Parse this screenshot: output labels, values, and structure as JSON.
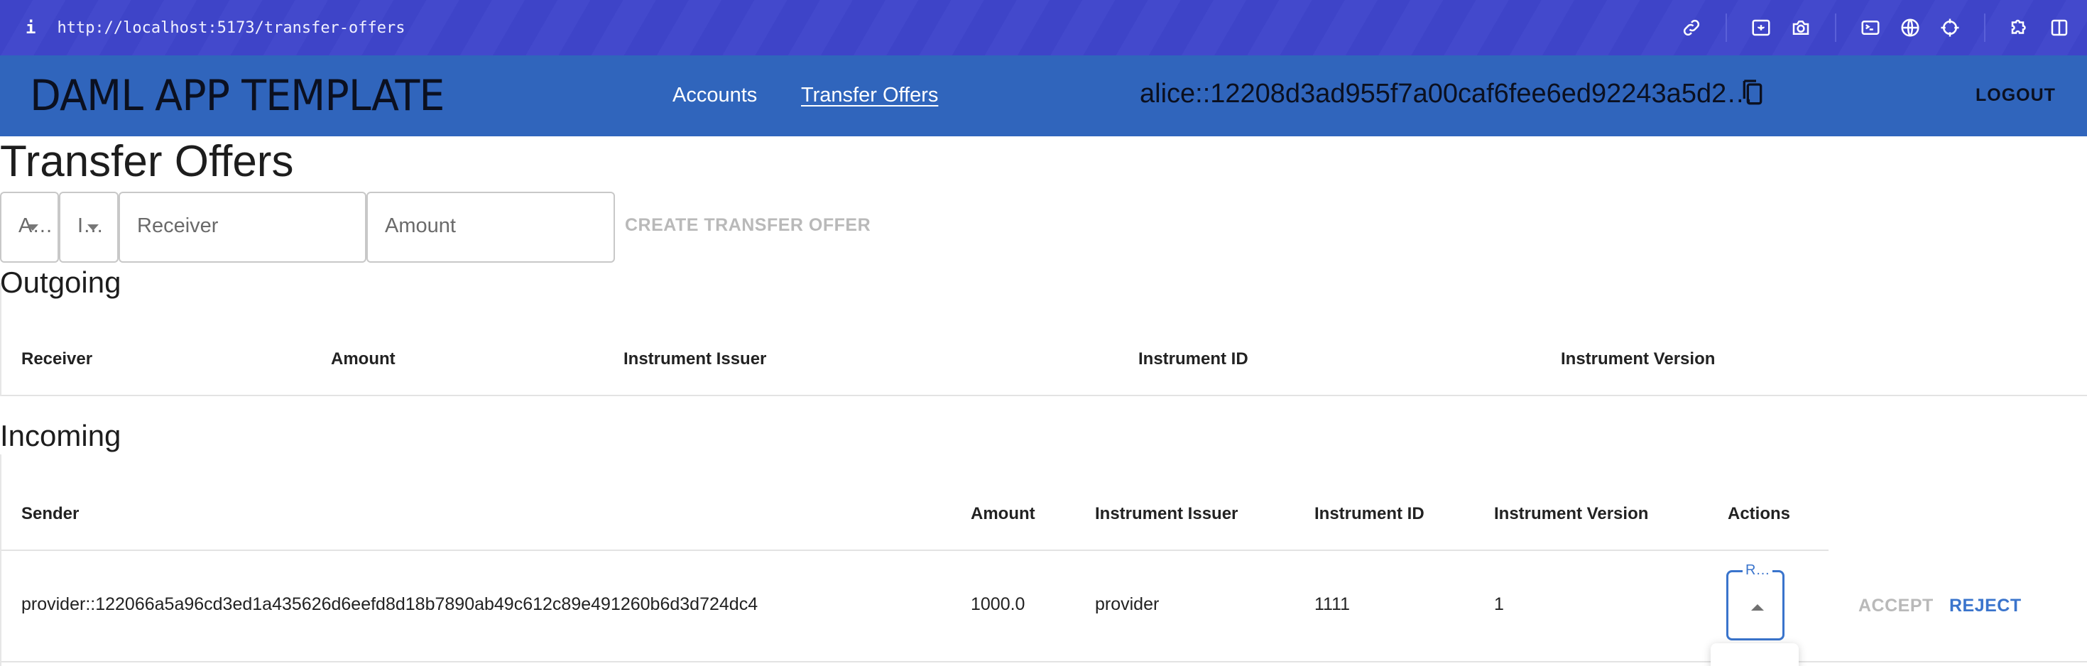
{
  "browser": {
    "url": "http://localhost:5173/transfer-offers",
    "info_icon": "i",
    "toolbar_icons": [
      "link-icon",
      "image-icon",
      "camera-icon",
      "terminal-icon",
      "globe-icon",
      "crosshair-icon",
      "puzzle-icon",
      "split-view-icon"
    ]
  },
  "header": {
    "title": "DAML APP TEMPLATE",
    "nav": [
      {
        "label": "Accounts",
        "active": false
      },
      {
        "label": "Transfer Offers",
        "active": true
      }
    ],
    "party_id": "alice::12208d3ad955f7a00caf6fee6ed92243a5d2…",
    "logout_label": "LOGOUT",
    "colors": {
      "header_bg": "#3065bc",
      "browser_bg": "#3e44c8"
    }
  },
  "page": {
    "title": "Transfer Offers",
    "form": {
      "account_select_value": "A…",
      "instrument_select_value": "I…",
      "receiver_placeholder": "Receiver",
      "amount_placeholder": "Amount",
      "create_label": "CREATE TRANSFER OFFER"
    },
    "outgoing": {
      "title": "Outgoing",
      "columns": [
        "Receiver",
        "Amount",
        "Instrument Issuer",
        "Instrument ID",
        "Instrument Version"
      ],
      "rows": []
    },
    "incoming": {
      "title": "Incoming",
      "columns": [
        "Sender",
        "Amount",
        "Instrument Issuer",
        "Instrument ID",
        "Instrument Version",
        "Actions"
      ],
      "rows": [
        {
          "sender": "provider::122066a5a96cd3ed1a435626d6eefd8d18b7890ab49c612c89e491260b6d3d724dc4",
          "amount": "1000.0",
          "instrument_issuer": "provider",
          "instrument_id": "1111",
          "instrument_version": "1",
          "action_select_label": "R…",
          "accept_label": "ACCEPT",
          "reject_label": "REJECT"
        }
      ]
    },
    "colors": {
      "accent": "#3a74cc",
      "disabled_text": "#b9b9b9"
    }
  }
}
